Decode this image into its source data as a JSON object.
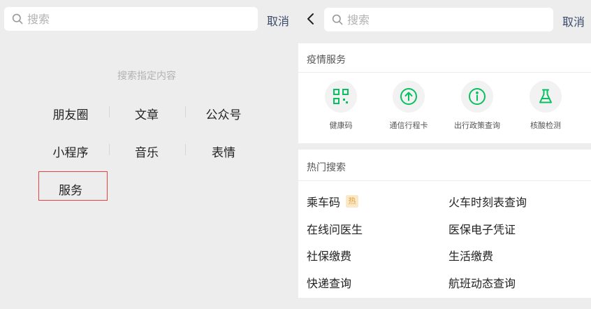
{
  "left": {
    "search": {
      "placeholder": "搜索"
    },
    "cancel_label": "取消",
    "hint": "搜索指定内容",
    "categories": [
      {
        "label": "朋友圈"
      },
      {
        "label": "文章"
      },
      {
        "label": "公众号"
      },
      {
        "label": "小程序"
      },
      {
        "label": "音乐"
      },
      {
        "label": "表情"
      },
      {
        "label": "服务"
      }
    ],
    "highlight_color": "#e64340"
  },
  "right": {
    "back_icon": "chevron-left-icon",
    "search": {
      "placeholder": "搜索"
    },
    "cancel_label": "取消",
    "epidemic": {
      "title": "疫情服务",
      "items": [
        {
          "label": "健康码",
          "icon": "qr-code-icon"
        },
        {
          "label": "通信行程卡",
          "icon": "arrow-up-circle-icon"
        },
        {
          "label": "出行政策查询",
          "icon": "info-circle-icon"
        },
        {
          "label": "核酸检测",
          "icon": "flask-icon"
        }
      ]
    },
    "hot_search": {
      "title": "热门搜索",
      "badge": "热",
      "items": [
        {
          "label": "乘车码"
        },
        {
          "label": "火车时刻表查询"
        },
        {
          "label": "在线问医生"
        },
        {
          "label": "医保电子凭证"
        },
        {
          "label": "社保缴费"
        },
        {
          "label": "生活缴费"
        },
        {
          "label": "快递查询"
        },
        {
          "label": "航班动态查询"
        }
      ]
    },
    "accent_color": "#07c160"
  }
}
